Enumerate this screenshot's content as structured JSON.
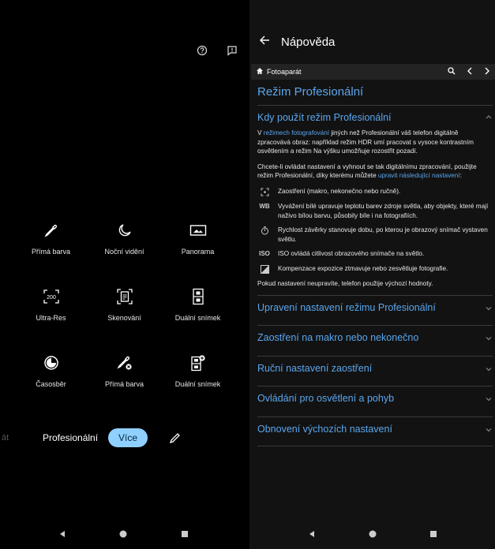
{
  "camera": {
    "modes": [
      {
        "label": "Přímá barva",
        "icon": "eyedropper-icon"
      },
      {
        "label": "Noční vidění",
        "icon": "moon-icon"
      },
      {
        "label": "Panorama",
        "icon": "panorama-icon"
      },
      {
        "label": "Ultra-Res",
        "icon": "ultra-res-icon"
      },
      {
        "label": "Skenování",
        "icon": "document-scan-icon"
      },
      {
        "label": "Duální snímek",
        "icon": "dual-shot-icon"
      },
      {
        "label": "Časosběr",
        "icon": "timelapse-icon"
      },
      {
        "label": "Přímá barva",
        "icon": "eyedropper-off-icon"
      },
      {
        "label": "Duální snímek",
        "icon": "dual-shot-add-icon"
      }
    ],
    "bottom_bar": {
      "faded": "át",
      "pro": "Profesionální",
      "more": "Více"
    },
    "ultra_res_badge": "200"
  },
  "help": {
    "title": "Nápověda",
    "breadcrumb": "Fotoaparát",
    "heading": "Režim Profesionální",
    "section1": {
      "title": "Kdy použít režim Profesionální",
      "p1_pre": "V ",
      "p1_link": "režimech fotografování",
      "p1_post": " jiných než Profesionální váš telefon digitálně zpracovává obraz: například režim HDR umí pracovat s vysoce kontrastním osvětlením a režim Na výšku umožňuje rozostřit pozadí.",
      "p2_pre": "Chcete-li ovládat nastavení a vyhnout se tak digitálnímu zpracování, použijte režim Profesionální, díky kterému můžete ",
      "p2_link": "upravit následující nastavení",
      "p2_post": ":",
      "items": [
        {
          "icon": "focus-icon",
          "text": "Zaostření (makro, nekonečno nebo ručně)."
        },
        {
          "icon": "wb-icon",
          "glyph": "WB",
          "text": "Vyvážení bílé upravuje teplotu barev zdroje světla, aby objekty, které mají naživo bílou barvu, působily bíle i na fotografiích."
        },
        {
          "icon": "shutter-speed-icon",
          "text": "Rychlost závěrky stanovuje dobu, po kterou je obrazový snímač vystaven světlu."
        },
        {
          "icon": "iso-icon",
          "glyph": "ISO",
          "text": "ISO ovládá citlivost obrazového snímače na světlo."
        },
        {
          "icon": "exposure-icon",
          "text": "Kompenzace expozice ztmavuje nebo zesvětluje fotografie."
        }
      ],
      "footer": "Pokud nastavení neupravíte, telefon použije výchozí hodnoty."
    },
    "accordions": [
      "Upravení nastavení režimu Profesionální",
      "Zaostření na makro nebo nekonečno",
      "Ruční nastavení zaostření",
      "Ovládání pro osvětlení a pohyb",
      "Obnovení výchozích nastavení"
    ]
  },
  "colors": {
    "accent": "#5aa7ee",
    "chip": "#8fd0ff"
  }
}
